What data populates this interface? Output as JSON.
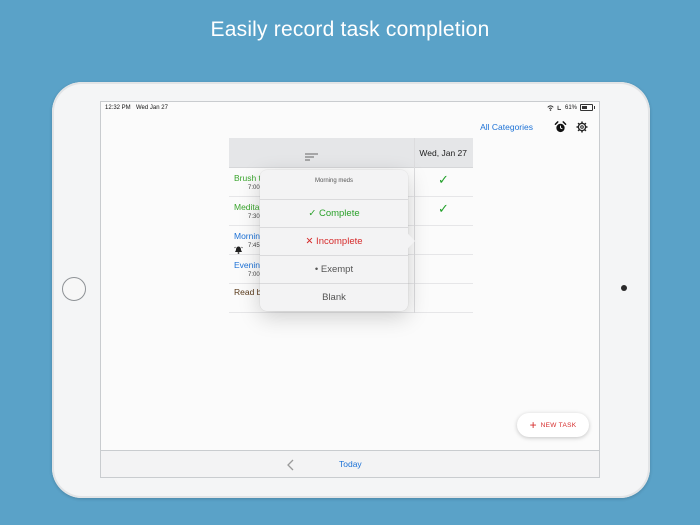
{
  "headline": "Easily record task completion",
  "status_bar": {
    "time": "12:32 PM",
    "date": "Wed Jan 27",
    "battery": "61%",
    "battery_level": 0.61
  },
  "nav": {
    "categories_label": "All Categories",
    "alarm_icon": "alarm-clock-icon",
    "settings_icon": "gear-icon"
  },
  "grid": {
    "sort_icon": "sort-lines-icon",
    "column_date": "Wed, Jan 27",
    "rows": [
      {
        "name": "Brush t",
        "time": "7:00",
        "color": "#3aa52d",
        "status": "✓"
      },
      {
        "name": "Medita",
        "time": "7:30",
        "color": "#3aa52d",
        "status": "✓"
      },
      {
        "name": "Mornin",
        "time": "7:45",
        "color": "#1d72d6",
        "status": ""
      },
      {
        "name": "Evenin",
        "time": "7:00",
        "color": "#1d72d6",
        "status": ""
      },
      {
        "name": "Read b",
        "time": "",
        "color": "#5a3a1a",
        "status": ""
      }
    ]
  },
  "popover": {
    "title": "Morning meds",
    "options": [
      {
        "label": "✓ Complete",
        "color": "#2aa12a"
      },
      {
        "label": "✕ Incomplete",
        "color": "#d62b2b"
      },
      {
        "label": "• Exempt",
        "color": "#555555"
      },
      {
        "label": "Blank",
        "color": "#555555"
      }
    ]
  },
  "new_task_button": {
    "label": "NEW TASK",
    "plus": "+"
  },
  "bottom_bar": {
    "today": "Today"
  }
}
